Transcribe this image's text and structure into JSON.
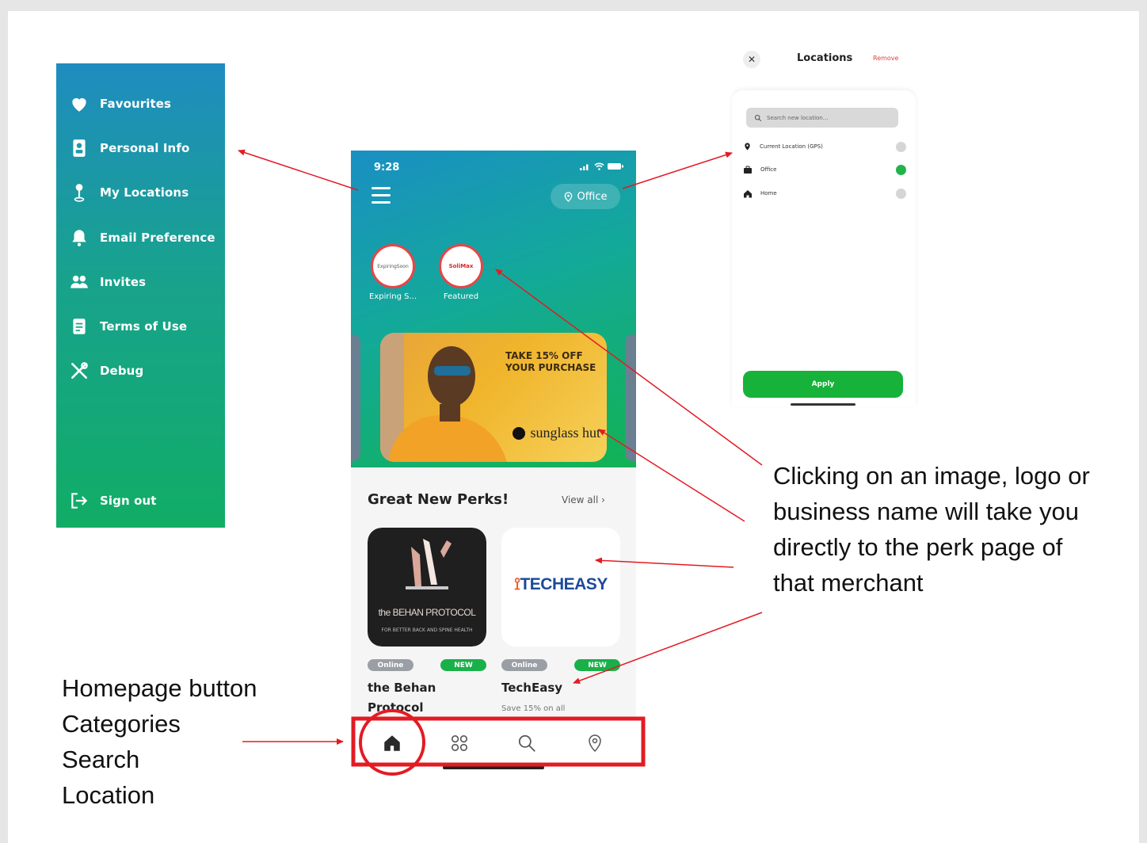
{
  "menu": {
    "items": [
      {
        "label": "Favourites",
        "icon": "heart-icon"
      },
      {
        "label": "Personal Info",
        "icon": "id-card-icon"
      },
      {
        "label": "My Locations",
        "icon": "location-pin-icon"
      },
      {
        "label": "Email Preference",
        "icon": "bell-icon"
      },
      {
        "label": "Invites",
        "icon": "users-icon"
      },
      {
        "label": "Terms of Use",
        "icon": "document-icon"
      },
      {
        "label": "Debug",
        "icon": "tools-icon"
      }
    ],
    "signout": {
      "label": "Sign out",
      "icon": "sign-out-icon"
    }
  },
  "phone": {
    "status_time": "9:28",
    "location_pill": "Office",
    "stories": [
      {
        "caption": "Expiring S...",
        "logo_text": "ExpiringSoon"
      },
      {
        "caption": "Featured",
        "logo_text": "SoliMax"
      }
    ],
    "banner": {
      "offer": "TAKE 15% OFF YOUR PURCHASE",
      "brand": "sunglass hut"
    },
    "section_title": "Great New Perks!",
    "view_all": "View all",
    "perks": [
      {
        "name": "the Behan Protocol",
        "chip_left": "Online",
        "chip_right": "NEW",
        "logo_text": "the BEHAN PROTOCOL",
        "logo_subtext": "FOR BETTER BACK AND SPINE HEALTH",
        "subtitle": ""
      },
      {
        "name": "TechEasy",
        "chip_left": "Online",
        "chip_right": "NEW",
        "logo_text": "TECHEASY",
        "logo_subtext": "",
        "subtitle": "Save 15% on all"
      }
    ],
    "tabs": [
      {
        "name": "home",
        "icon": "home-icon"
      },
      {
        "name": "categories",
        "icon": "grid-icon"
      },
      {
        "name": "search",
        "icon": "search-icon"
      },
      {
        "name": "location",
        "icon": "location-icon"
      }
    ]
  },
  "locations": {
    "close": "✕",
    "title": "Locations",
    "remove": "Remove",
    "search_placeholder": "Search new location...",
    "rows": [
      {
        "label": "Current Location (GPS)",
        "icon": "pin-icon",
        "selected": false
      },
      {
        "label": "Office",
        "icon": "briefcase-icon",
        "selected": true
      },
      {
        "label": "Home",
        "icon": "home-icon",
        "selected": false
      }
    ],
    "apply": "Apply"
  },
  "annotations": {
    "right_lines": [
      "Clicking on an image, logo or",
      "business name will take you",
      "directly to the perk page of",
      "that merchant"
    ],
    "left_lines": [
      "Homepage button",
      "Categories",
      "Search",
      "Location"
    ]
  },
  "colors": {
    "menu_gradient_top": "#1f8cc0",
    "menu_gradient_bottom": "#11ad66",
    "annotation_red": "#e31b23",
    "selected_green": "#22b34a",
    "apply_green": "#16b23a"
  }
}
